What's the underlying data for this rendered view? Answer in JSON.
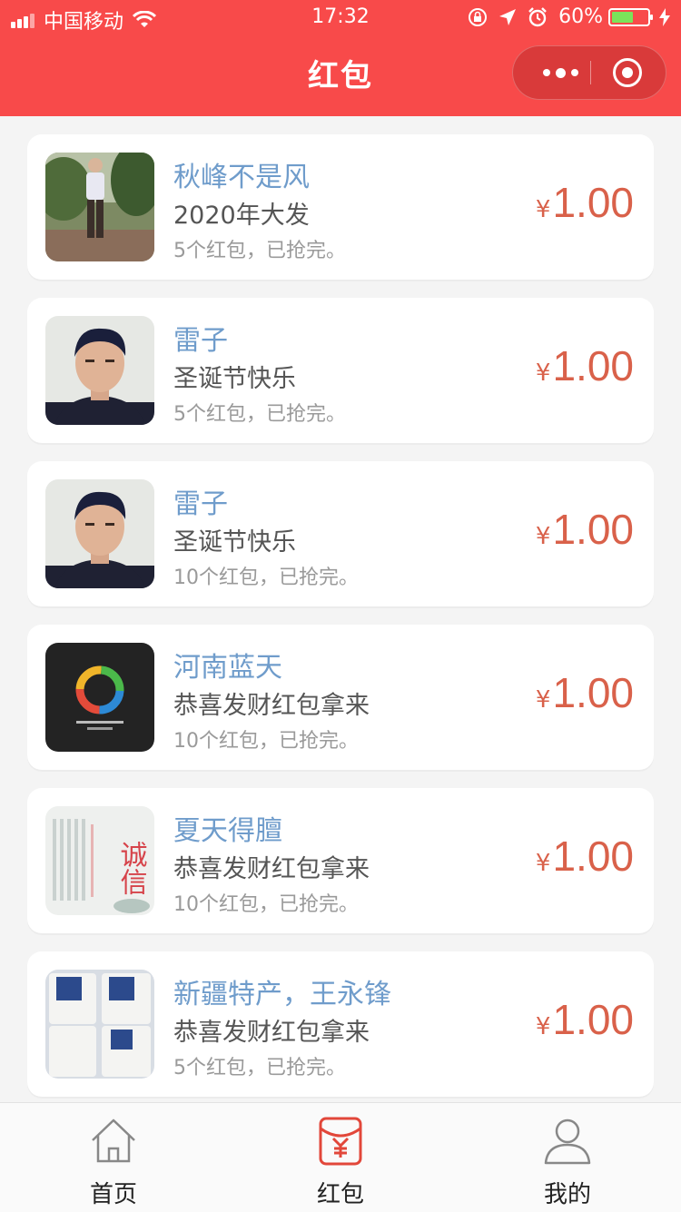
{
  "status_bar": {
    "carrier": "中国移动",
    "time": "17:32",
    "battery": "60%",
    "battery_level": 0.6
  },
  "nav": {
    "title": "红包"
  },
  "colors": {
    "brand": "#f84a4a",
    "name": "#6f9ccb",
    "amount": "#d9614a"
  },
  "items": [
    {
      "name": "秋峰不是风",
      "message": "2020年大发",
      "count": "5个红包，已抢完。",
      "currency": "¥",
      "amount": "1.00",
      "avatar": "man-standing-garden"
    },
    {
      "name": "雷子",
      "message": "圣诞节快乐",
      "count": "5个红包，已抢完。",
      "currency": "¥",
      "amount": "1.00",
      "avatar": "young-man-portrait"
    },
    {
      "name": "雷子",
      "message": "圣诞节快乐",
      "count": "10个红包，已抢完。",
      "currency": "¥",
      "amount": "1.00",
      "avatar": "young-man-portrait"
    },
    {
      "name": "河南蓝天",
      "message": "恭喜发财红包拿来",
      "count": "10个红包，已抢完。",
      "currency": "¥",
      "amount": "1.00",
      "avatar": "ring-logo"
    },
    {
      "name": "夏天得膻",
      "message": "恭喜发财红包拿来",
      "count": "10个红包，已抢完。",
      "currency": "¥",
      "amount": "1.00",
      "avatar": "calligraphy-chengxin"
    },
    {
      "name": "新疆特产，王永锋",
      "message": "恭喜发财红包拿来",
      "count": "5个红包，已抢完。",
      "currency": "¥",
      "amount": "1.00",
      "avatar": "yogurt-product"
    }
  ],
  "avatar_text": {
    "calligraphy": "诚信"
  },
  "tabs": [
    {
      "label": "首页",
      "icon": "home-icon",
      "active": false
    },
    {
      "label": "红包",
      "icon": "red-packet-icon",
      "active": true
    },
    {
      "label": "我的",
      "icon": "user-icon",
      "active": false
    }
  ]
}
